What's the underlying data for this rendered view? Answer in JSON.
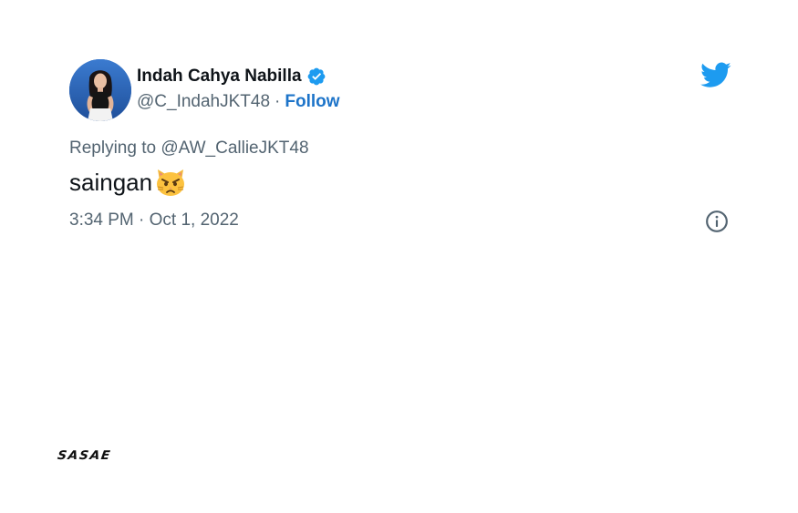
{
  "tweet": {
    "author_name": "Indah Cahya Nabilla",
    "author_handle": "@C_IndahJKT48",
    "separator": "·",
    "follow_label": "Follow",
    "replying_prefix": "Replying to",
    "replying_handle": "@AW_CallieJKT48",
    "text": "saingan",
    "timestamp": "3:34 PM · Oct 1, 2022"
  },
  "icons": {
    "verified": "verified-badge-icon",
    "twitter": "twitter-bird-icon",
    "emoji": "pouting-cat-emoji-icon",
    "info": "info-icon"
  },
  "brand": {
    "logo_text": "SASAE"
  },
  "colors": {
    "accent": "#1d9bf0",
    "follow_link": "#1d74c9",
    "secondary_text": "#536471",
    "primary_text": "#0f1419"
  }
}
